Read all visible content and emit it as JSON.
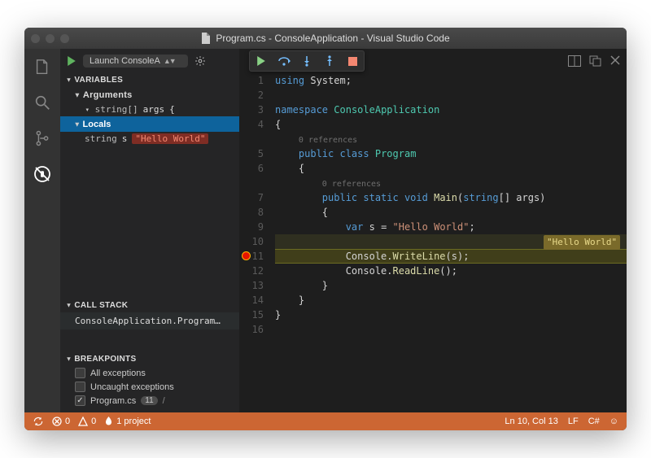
{
  "window": {
    "title": "Program.cs - ConsoleApplication - Visual Studio Code"
  },
  "sidebar": {
    "launchConfig": "Launch ConsoleA",
    "sections": {
      "variables": {
        "label": "VARIABLES",
        "arguments": {
          "label": "Arguments",
          "item": {
            "type": "string[]",
            "name": "args",
            "value": "{"
          }
        },
        "locals": {
          "label": "Locals",
          "item": {
            "type": "string",
            "name": "s",
            "value": "\"Hello World\""
          }
        }
      },
      "callstack": {
        "label": "CALL STACK",
        "frame": "ConsoleApplication.Program..."
      },
      "breakpoints": {
        "label": "BREAKPOINTS",
        "items": [
          {
            "label": "All exceptions",
            "checked": false
          },
          {
            "label": "Uncaught exceptions",
            "checked": false
          },
          {
            "label": "Program.cs",
            "checked": true,
            "badge": "11",
            "path": "/"
          }
        ]
      }
    }
  },
  "editor": {
    "inlineValue": "\"Hello World\"",
    "lines": [
      {
        "n": 1,
        "html": "<span class='tok-key'>using</span> System;"
      },
      {
        "n": 2,
        "html": ""
      },
      {
        "n": 3,
        "html": "<span class='tok-key'>namespace</span> <span class='tok-cls'>ConsoleApplication</span>"
      },
      {
        "n": 4,
        "html": "{"
      },
      {
        "n": "",
        "html": "    <span class='codelens'>0 references</span>"
      },
      {
        "n": 5,
        "html": "    <span class='tok-key'>public class</span> <span class='tok-cls'>Program</span>"
      },
      {
        "n": 6,
        "html": "    {"
      },
      {
        "n": "",
        "html": "        <span class='codelens'>0 references</span>"
      },
      {
        "n": 7,
        "html": "        <span class='tok-key'>public static</span> <span class='tok-key'>void</span> <span class='tok-fn'>Main</span>(<span class='tok-key'>string</span>[] args)"
      },
      {
        "n": 8,
        "html": "        {"
      },
      {
        "n": 9,
        "html": "            <span class='tok-key'>var</span> s = <span class='tok-str'>\"Hello World\"</span>;"
      },
      {
        "n": 10,
        "html": ""
      },
      {
        "n": 11,
        "html": "            Console.<span class='tok-fn'>WriteLine</span>(s);"
      },
      {
        "n": 12,
        "html": "            Console.<span class='tok-fn'>ReadLine</span>();"
      },
      {
        "n": 13,
        "html": "        }"
      },
      {
        "n": 14,
        "html": "    }"
      },
      {
        "n": 15,
        "html": "}"
      },
      {
        "n": 16,
        "html": ""
      }
    ]
  },
  "status": {
    "sync": "⟲",
    "errors": "0",
    "warnings": "0",
    "flame": "1 project",
    "position": "Ln 10, Col 13",
    "eol": "LF",
    "lang": "C#"
  }
}
